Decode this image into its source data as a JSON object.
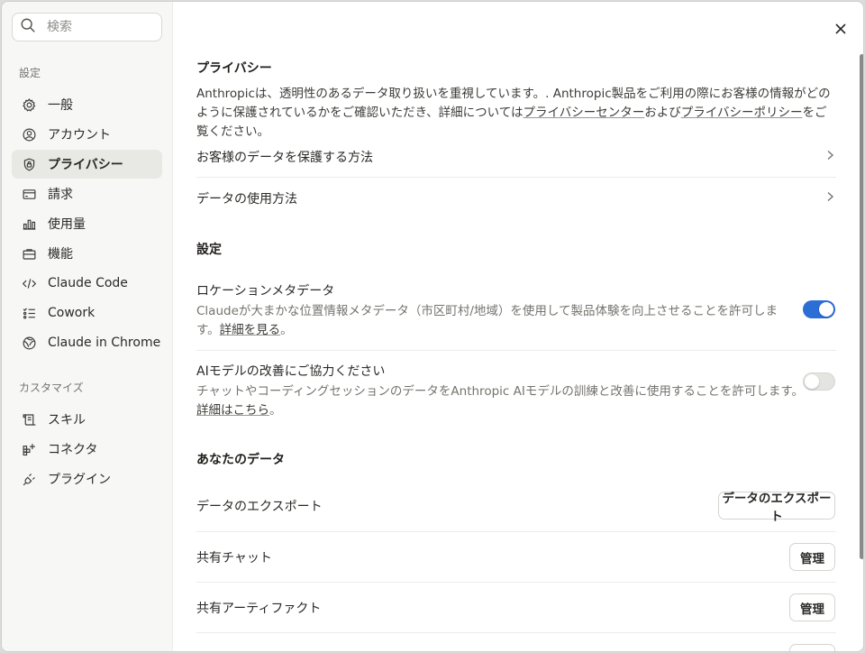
{
  "search": {
    "placeholder": "検索"
  },
  "sidebar": {
    "settings_label": "設定",
    "customize_label": "カスタマイズ",
    "items": [
      {
        "label": "一般",
        "icon": "gear-icon"
      },
      {
        "label": "アカウント",
        "icon": "user-circle-icon"
      },
      {
        "label": "プライバシー",
        "icon": "shield-lock-icon",
        "active": true
      },
      {
        "label": "請求",
        "icon": "credit-card-icon"
      },
      {
        "label": "使用量",
        "icon": "bar-chart-icon"
      },
      {
        "label": "機能",
        "icon": "briefcase-icon"
      },
      {
        "label": "Claude Code",
        "icon": "code-icon"
      },
      {
        "label": "Cowork",
        "icon": "checklist-icon"
      },
      {
        "label": "Claude in Chrome",
        "icon": "globe-icon"
      }
    ],
    "customize_items": [
      {
        "label": "スキル",
        "icon": "scroll-icon"
      },
      {
        "label": "コネクタ",
        "icon": "grid-plus-icon"
      },
      {
        "label": "プラグイン",
        "icon": "plug-icon"
      }
    ]
  },
  "privacy": {
    "title": "プライバシー",
    "intro_before": "Anthropicは、透明性のあるデータ取り扱いを重視しています。. Anthropic製品をご利用の際にお客様の情報がどのように保護されているかをご確認いただき、詳細については",
    "privacy_center_link": "プライバシーセンター",
    "intro_and": "および",
    "privacy_policy_link": "プライバシーポリシー",
    "intro_after": "をご覧ください。",
    "links": [
      {
        "label": "お客様のデータを保護する方法"
      },
      {
        "label": "データの使用方法"
      }
    ]
  },
  "settings": {
    "title": "設定",
    "location": {
      "title": "ロケーションメタデータ",
      "desc": "Claudeが大まかな位置情報メタデータ（市区町村/地域）を使用して製品体験を向上させることを許可します。",
      "link": "詳細を見る",
      "period": "。",
      "enabled": true
    },
    "improve": {
      "title": "AIモデルの改善にご協力ください",
      "desc": "チャットやコーディングセッションのデータをAnthropic AIモデルの訓練と改善に使用することを許可します。",
      "link": "詳細はこちら",
      "period": "。",
      "enabled": false
    }
  },
  "your_data": {
    "title": "あなたのデータ",
    "rows": [
      {
        "label": "データのエクスポート",
        "button": "データのエクスポート"
      },
      {
        "label": "共有チャット",
        "button": "管理"
      },
      {
        "label": "共有アーティファクト",
        "button": "管理"
      }
    ]
  },
  "colors": {
    "accent": "#2c6ed6",
    "sidebar_bg": "#f7f7f5",
    "active_bg": "#e8e8e4"
  }
}
